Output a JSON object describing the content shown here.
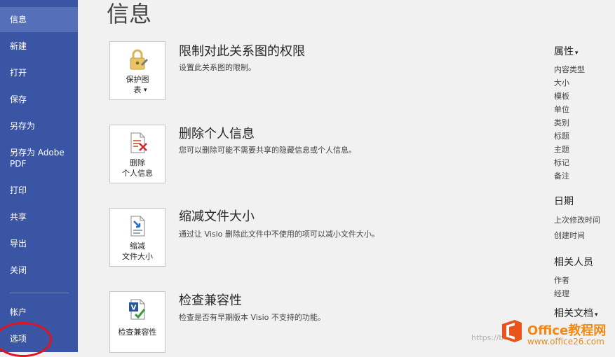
{
  "sidebar": {
    "items": [
      {
        "label": "信息"
      },
      {
        "label": "新建"
      },
      {
        "label": "打开"
      },
      {
        "label": "保存"
      },
      {
        "label": "另存为"
      },
      {
        "label": "另存为 Adobe PDF"
      },
      {
        "label": "打印"
      },
      {
        "label": "共享"
      },
      {
        "label": "导出"
      },
      {
        "label": "关闭"
      },
      {
        "label": "帐户"
      },
      {
        "label": "选项"
      }
    ]
  },
  "main": {
    "title": "信息",
    "sections": [
      {
        "button": "保护图\n表",
        "title": "限制对此关系图的权限",
        "desc": "设置此关系图的限制。",
        "icon": "lock-icon"
      },
      {
        "button": "删除\n个人信息",
        "title": "删除个人信息",
        "desc": "您可以删除可能不需要共享的隐藏信息或个人信息。",
        "icon": "remove-info-icon"
      },
      {
        "button": "缩减\n文件大小",
        "title": "缩减文件大小",
        "desc": "通过让 Visio 删除此文件中不使用的项可以减小文件大小。",
        "icon": "reduce-size-icon"
      },
      {
        "button": "检查兼容性",
        "title": "检查兼容性",
        "desc": "检查是否有早期版本 Visio 不支持的功能。",
        "icon": "check-compat-icon"
      }
    ]
  },
  "properties": {
    "heading": "属性",
    "items": [
      "内容类型",
      "大小",
      "模板",
      "单位",
      "类别",
      "标题",
      "主题",
      "标记",
      "备注"
    ],
    "dates_heading": "日期",
    "dates": [
      "上次修改时间",
      "创建时间"
    ],
    "people_heading": "相关人员",
    "people": [
      "作者",
      "经理"
    ],
    "docs_heading": "相关文档"
  },
  "watermark": {
    "url": "https://bl",
    "brand": "Office教程网",
    "site": "www.office26.com"
  },
  "colors": {
    "sidebar": "#3955a3",
    "sidebar_active": "#5570b8",
    "background": "#f1f1f1",
    "highlight_circle": "#e0141e",
    "watermark": "#f08a15"
  }
}
